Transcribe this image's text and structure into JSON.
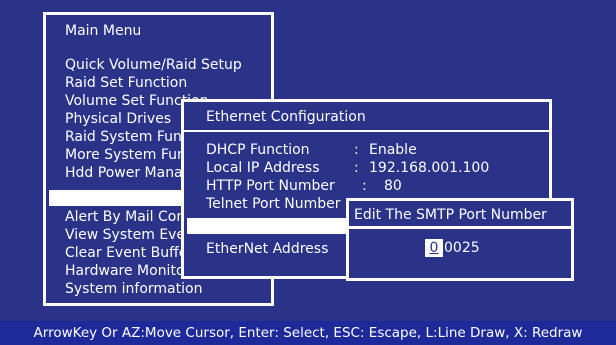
{
  "main_menu": {
    "title": "Main Menu",
    "items": [
      "Quick Volume/Raid Setup",
      "Raid Set Function",
      "Volume Set Function",
      "Physical Drives",
      "Raid System Function",
      "More System Functions",
      "Hdd Power Management",
      "",
      "Alert By Mail Config",
      "View System Events",
      "Clear Event Buffer",
      "Hardware Monitor",
      "System information"
    ]
  },
  "ethernet": {
    "title": "Ethernet Configuration",
    "rows": [
      {
        "label": "DHCP Function",
        "value": "Enable"
      },
      {
        "label": "Local IP Address",
        "value": "192.168.001.100"
      },
      {
        "label": "HTTP  Port  Number",
        "value": "80"
      },
      {
        "label": "Telnet  Port  Number",
        "value": ""
      },
      {
        "label": "",
        "value": ""
      },
      {
        "label": "EtherNet  Address",
        "value": ""
      }
    ]
  },
  "smtp_dialog": {
    "title": "Edit The SMTP Port Number",
    "cursor_digit": "0",
    "rest_digits": "0025"
  },
  "statusbar": {
    "text": "ArrowKey Or AZ:Move Cursor, Enter: Select, ESC: Escape, L:Line Draw, X: Redraw"
  }
}
